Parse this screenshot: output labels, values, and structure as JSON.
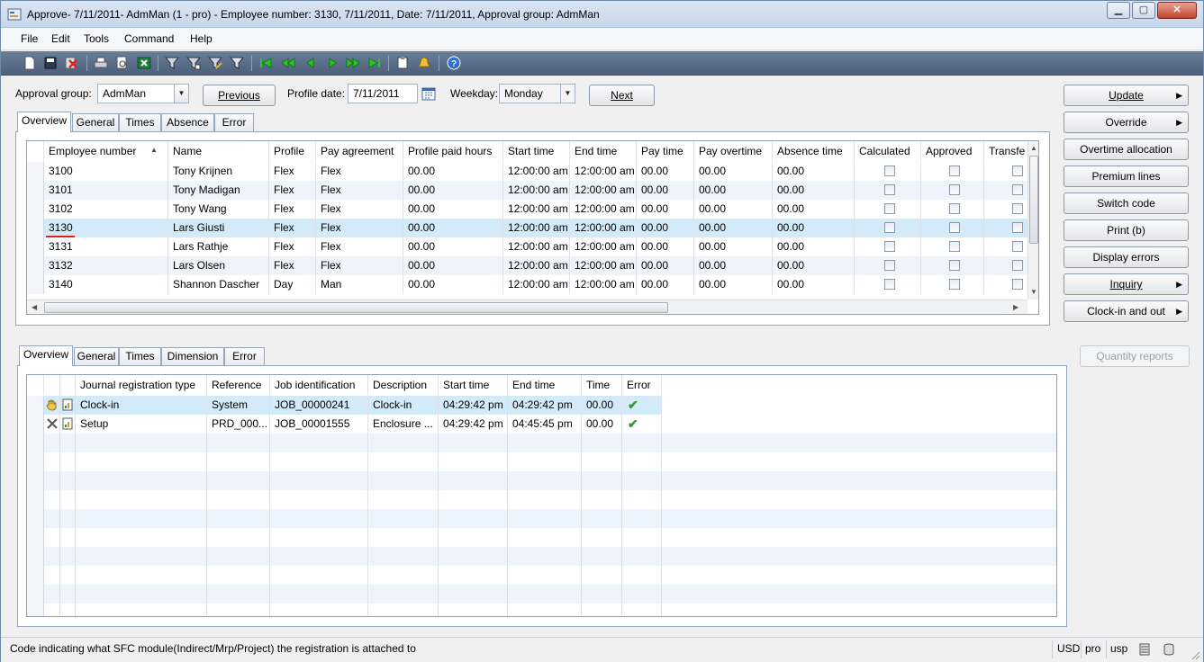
{
  "window": {
    "title": "Approve- 7/11/2011- AdmMan (1 - pro) - Employee number: 3130, 7/11/2011, Date: 7/11/2011, Approval group: AdmMan",
    "minimize": "▁",
    "maximize": "▢",
    "close": "✕"
  },
  "menu": [
    "File",
    "Edit",
    "Tools",
    "Command",
    "Help"
  ],
  "toolbar_icons": [
    "new-icon",
    "save-icon",
    "delete-icon",
    "print-icon",
    "print-preview-icon",
    "excel-icon",
    "filter-by-selection-icon",
    "filter-by-grid-icon",
    "advanced-filter-icon",
    "remove-filter-icon",
    "first-record-icon",
    "previous-page-icon",
    "previous-record-icon",
    "next-record-icon",
    "next-page-icon",
    "last-record-icon",
    "attachment-icon",
    "alert-icon",
    "help-icon"
  ],
  "header": {
    "approval_group_label": "Approval group:",
    "approval_group_value": "AdmMan",
    "previous_button": "Previous",
    "profile_date_label": "Profile date:",
    "profile_date_value": "7/11/2011",
    "weekday_label": "Weekday:",
    "weekday_value": "Monday",
    "next_button": "Next"
  },
  "top_tabs": [
    "Overview",
    "General",
    "Times",
    "Absence",
    "Error"
  ],
  "top_grid": {
    "columns": [
      "Employee number",
      "Name",
      "Profile",
      "Pay agreement",
      "Profile paid hours",
      "Start time",
      "End time",
      "Pay time",
      "Pay overtime",
      "Absence time",
      "Calculated",
      "Approved",
      "Transfe"
    ],
    "sort_indicator": "▲",
    "rows": [
      [
        "3100",
        "Tony Krijnen",
        "Flex",
        "Flex",
        "00.00",
        "12:00:00 am",
        "12:00:00 am",
        "00.00",
        "00.00",
        "00.00"
      ],
      [
        "3101",
        "Tony Madigan",
        "Flex",
        "Flex",
        "00.00",
        "12:00:00 am",
        "12:00:00 am",
        "00.00",
        "00.00",
        "00.00"
      ],
      [
        "3102",
        "Tony Wang",
        "Flex",
        "Flex",
        "00.00",
        "12:00:00 am",
        "12:00:00 am",
        "00.00",
        "00.00",
        "00.00"
      ],
      [
        "3130",
        "Lars Giusti",
        "Flex",
        "Flex",
        "00.00",
        "12:00:00 am",
        "12:00:00 am",
        "00.00",
        "00.00",
        "00.00"
      ],
      [
        "3131",
        "Lars Rathje",
        "Flex",
        "Flex",
        "00.00",
        "12:00:00 am",
        "12:00:00 am",
        "00.00",
        "00.00",
        "00.00"
      ],
      [
        "3132",
        "Lars Olsen",
        "Flex",
        "Flex",
        "00.00",
        "12:00:00 am",
        "12:00:00 am",
        "00.00",
        "00.00",
        "00.00"
      ],
      [
        "3140",
        "Shannon Dascher",
        "Day",
        "Man",
        "00.00",
        "12:00:00 am",
        "12:00:00 am",
        "00.00",
        "00.00",
        "00.00"
      ]
    ],
    "selected_row": 3
  },
  "side_buttons": {
    "update": "Update",
    "override": "Override",
    "overtime_allocation": "Overtime allocation",
    "premium_lines": "Premium lines",
    "switch_code": "Switch code",
    "print": "Print (b)",
    "display_errors": "Display errors",
    "inquiry": "Inquiry",
    "clock_in_and_out": "Clock-in and out",
    "quantity_reports": "Quantity reports"
  },
  "bottom_tabs": [
    "Overview",
    "General",
    "Times",
    "Dimension",
    "Error"
  ],
  "bottom_grid": {
    "columns": [
      "Journal registration type",
      "Reference",
      "Job identification",
      "Description",
      "Start time",
      "End time",
      "Time",
      "Error"
    ],
    "rows": [
      {
        "icon": "hand-icon",
        "values": [
          "Clock-in",
          "System",
          "JOB_00000241",
          "Clock-in",
          "04:29:42 pm",
          "04:29:42 pm",
          "00.00"
        ]
      },
      {
        "icon": "tools-icon",
        "values": [
          "Setup",
          "PRD_000...",
          "JOB_00001555",
          "Enclosure ...",
          "04:29:42 pm",
          "04:45:45 pm",
          "00.00"
        ]
      }
    ],
    "error_glyph": "✔"
  },
  "status": {
    "text": "Code indicating what SFC module(Indirect/Mrp/Project) the registration is attached to",
    "currency": "USD",
    "company": "pro",
    "layer": "usp"
  }
}
